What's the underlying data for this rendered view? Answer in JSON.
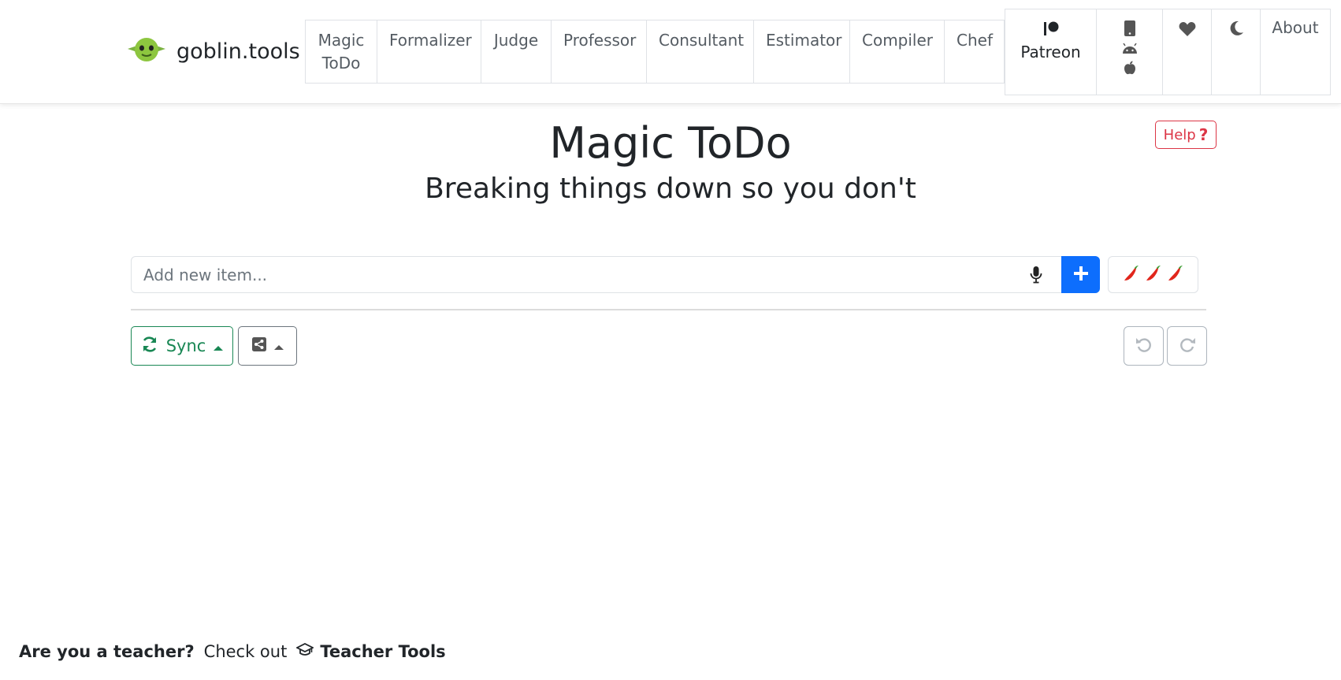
{
  "brand": {
    "name": "goblin.tools",
    "logo_icon": "goblin-face-icon"
  },
  "nav": {
    "items": [
      {
        "line1": "Magic",
        "line2": "ToDo"
      },
      {
        "line1": "Formalizer",
        "line2": ""
      },
      {
        "line1": "Judge",
        "line2": ""
      },
      {
        "line1": "Professor",
        "line2": ""
      },
      {
        "line1": "Consultant",
        "line2": ""
      },
      {
        "line1": "Estimator",
        "line2": ""
      },
      {
        "line1": "Compiler",
        "line2": ""
      },
      {
        "line1": "Chef",
        "line2": ""
      }
    ],
    "patreon_label": "Patreon",
    "about_label": "About",
    "icons": [
      "patreon-icon",
      "mobile-icon",
      "android-icon",
      "apple-icon",
      "heart-icon",
      "moon-icon"
    ]
  },
  "page": {
    "title": "Magic ToDo",
    "subtitle": "Breaking things down so you don't",
    "help_label": "Help"
  },
  "todo": {
    "input_placeholder": "Add new item...",
    "spiciness_icons": [
      "chili-pepper-icon",
      "chili-pepper-icon",
      "chili-pepper-icon"
    ]
  },
  "toolbar": {
    "sync_label": "Sync"
  },
  "footer": {
    "question": "Are you a teacher?",
    "check_out": "Check out",
    "link_label": "Teacher Tools"
  },
  "colors": {
    "primary": "#0d6efd",
    "success": "#198754",
    "danger": "#dc3545",
    "secondary": "#6c757d",
    "goblin_green": "#8dc63f",
    "chili_red": "#e1261c"
  }
}
